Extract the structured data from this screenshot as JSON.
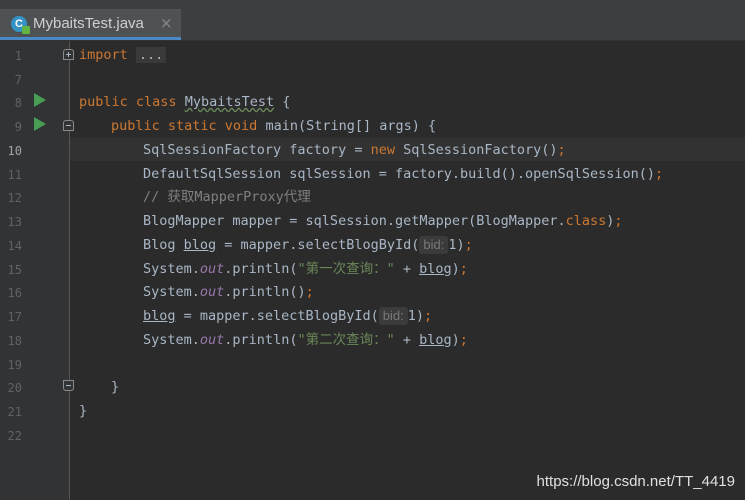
{
  "tab": {
    "title": "MybaitsTest.java",
    "icon": "java-class-icon",
    "close": "×"
  },
  "gutter": {
    "line_numbers": [
      "1",
      "7",
      "8",
      "9",
      "10",
      "11",
      "12",
      "13",
      "14",
      "15",
      "16",
      "17",
      "18",
      "19",
      "20",
      "21",
      "22"
    ],
    "current_line": "10"
  },
  "code": {
    "l1_import": "import",
    "l1_fold": "...",
    "l8_kw": "public class",
    "l8_name": "MybaitsTest",
    "l8_rest": " {",
    "l9_kw": "public static void",
    "l9_rest": " main(String[] args) {",
    "l10_a": "SqlSessionFactory factory = ",
    "l10_new": "new",
    "l10_b": " SqlSessionFactory()",
    "semi": ";",
    "l11": "DefaultSqlSession sqlSession = factory.build().openSqlSession()",
    "l12": "// 获取MapperProxy代理",
    "l13_a": "BlogMapper mapper = sqlSession.getMapper(BlogMapper.",
    "l13_class": "class",
    "l13_b": ")",
    "l14_a": "Blog ",
    "l14_var": "blog",
    "l14_b": " = mapper.selectBlogById(",
    "hint_bid": "bid:",
    "arg_1": "1",
    "close_paren": ")",
    "system": "System.",
    "out": "out",
    "println_open": ".println(",
    "str_first": "\"第一次查询：\"",
    "plus": " + ",
    "println_empty": ".println()",
    "l17_var": "blog",
    "l17_b": " = mapper.selectBlogById(",
    "str_second": "\"第二次查询：\"",
    "l20": "}",
    "l21": "}"
  },
  "watermark": "https://blog.csdn.net/TT_4419"
}
